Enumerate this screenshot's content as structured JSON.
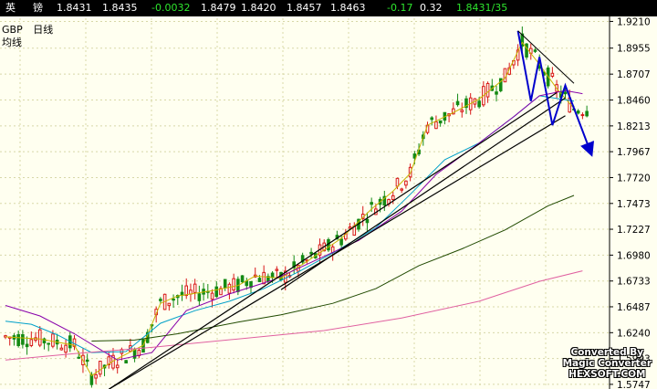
{
  "quote_bar": {
    "name_1": "英",
    "name_2": "镑",
    "items": [
      {
        "text": "1.8431",
        "color": "white"
      },
      {
        "text": "1.8435",
        "color": "white"
      },
      {
        "text": "-0.0032",
        "color": "green"
      },
      {
        "text": "1.8479",
        "color": "white"
      },
      {
        "text": "1.8420",
        "color": "white"
      },
      {
        "text": "1.8457",
        "color": "white"
      },
      {
        "text": "1.8463",
        "color": "white"
      },
      {
        "text": "-0.17",
        "color": "green"
      },
      {
        "text": "0.32",
        "color": "white"
      },
      {
        "text": "1.8431/35",
        "color": "green"
      }
    ]
  },
  "chart_labels": {
    "symbol": "GBP",
    "period": "日线",
    "indicator": "均线"
  },
  "watermark": {
    "line1": "Converted By",
    "line2": "Magic Converter",
    "line3": "HEXSOFT.COM"
  },
  "colors": {
    "background": "#fffff0",
    "grid": "#d8d8a8",
    "candle_up": "#d81818",
    "candle_down": "#148a14",
    "ma_short": "#c8b400",
    "ma_mid": "#00a0c8",
    "ma_long1": "#8800aa",
    "ma_long2": "#204a00",
    "ma_long3": "#e060a0",
    "trendline": "#000000",
    "arrow": "#0000cc"
  },
  "chart_data": {
    "type": "candlestick",
    "y_ticks": [
      "1.9210",
      "1.8955",
      "1.8707",
      "1.8460",
      "1.8213",
      "1.7967",
      "1.7720",
      "1.7473",
      "1.7227",
      "1.6980",
      "1.6733",
      "1.6487",
      "1.6240",
      "1.5993",
      "1.5747"
    ],
    "ylim": [
      1.572,
      1.924
    ],
    "x_count": 140,
    "ohlc": [],
    "moving_averages": [
      {
        "key": "ma_short",
        "points": [
          [
            0,
            1.62
          ],
          [
            8,
            1.618
          ],
          [
            16,
            1.612
          ],
          [
            20,
            1.583
          ],
          [
            25,
            1.597
          ],
          [
            32,
            1.612
          ],
          [
            36,
            1.652
          ],
          [
            40,
            1.659
          ],
          [
            48,
            1.664
          ],
          [
            54,
            1.669
          ],
          [
            58,
            1.678
          ],
          [
            64,
            1.676
          ],
          [
            70,
            1.692
          ],
          [
            78,
            1.714
          ],
          [
            85,
            1.742
          ],
          [
            90,
            1.759
          ],
          [
            94,
            1.776
          ],
          [
            98,
            1.822
          ],
          [
            104,
            1.834
          ],
          [
            110,
            1.847
          ],
          [
            116,
            1.867
          ],
          [
            120,
            1.901
          ],
          [
            124,
            1.88
          ],
          [
            128,
            1.857
          ],
          [
            132,
            1.838
          ]
        ]
      },
      {
        "key": "ma_mid",
        "points": [
          [
            0,
            1.635
          ],
          [
            6,
            1.632
          ],
          [
            12,
            1.622
          ],
          [
            20,
            1.605
          ],
          [
            28,
            1.606
          ],
          [
            36,
            1.633
          ],
          [
            44,
            1.645
          ],
          [
            52,
            1.654
          ],
          [
            60,
            1.666
          ],
          [
            68,
            1.682
          ],
          [
            76,
            1.7
          ],
          [
            86,
            1.724
          ],
          [
            94,
            1.756
          ],
          [
            102,
            1.789
          ],
          [
            110,
            1.805
          ],
          [
            118,
            1.83
          ],
          [
            124,
            1.85
          ],
          [
            132,
            1.845
          ]
        ]
      },
      {
        "key": "ma_long1",
        "points": [
          [
            0,
            1.65
          ],
          [
            8,
            1.64
          ],
          [
            16,
            1.623
          ],
          [
            26,
            1.598
          ],
          [
            34,
            1.605
          ],
          [
            42,
            1.645
          ],
          [
            52,
            1.661
          ],
          [
            62,
            1.674
          ],
          [
            72,
            1.693
          ],
          [
            82,
            1.712
          ],
          [
            92,
            1.74
          ],
          [
            100,
            1.775
          ],
          [
            110,
            1.805
          ],
          [
            118,
            1.83
          ],
          [
            124,
            1.85
          ],
          [
            130,
            1.855
          ],
          [
            134,
            1.852
          ]
        ]
      },
      {
        "key": "ma_long2",
        "points": [
          [
            20,
            1.616
          ],
          [
            30,
            1.617
          ],
          [
            40,
            1.623
          ],
          [
            54,
            1.634
          ],
          [
            64,
            1.641
          ],
          [
            76,
            1.652
          ],
          [
            86,
            1.666
          ],
          [
            96,
            1.688
          ],
          [
            106,
            1.704
          ],
          [
            116,
            1.722
          ],
          [
            126,
            1.745
          ],
          [
            132,
            1.755
          ]
        ]
      },
      {
        "key": "ma_long3",
        "points": [
          [
            0,
            1.598
          ],
          [
            16,
            1.604
          ],
          [
            34,
            1.61
          ],
          [
            54,
            1.618
          ],
          [
            74,
            1.626
          ],
          [
            92,
            1.638
          ],
          [
            110,
            1.654
          ],
          [
            124,
            1.673
          ],
          [
            134,
            1.683
          ]
        ]
      }
    ],
    "trendlines": [
      {
        "from": [
          24,
          1.57
        ],
        "to": [
          128,
          1.853
        ]
      },
      {
        "from": [
          24,
          1.57
        ],
        "to": [
          130,
          1.831
        ]
      },
      {
        "from": [
          64,
          1.665
        ],
        "to": [
          130,
          1.848
        ]
      }
    ],
    "arrow_paths": [
      {
        "points": [
          [
            119,
            1.912
          ],
          [
            122,
            1.845
          ],
          [
            124,
            1.887
          ],
          [
            127,
            1.822
          ],
          [
            130,
            1.86
          ],
          [
            136,
            1.795
          ]
        ]
      },
      {
        "points": [
          [
            119,
            1.912
          ],
          [
            132,
            1.862
          ]
        ]
      }
    ]
  }
}
